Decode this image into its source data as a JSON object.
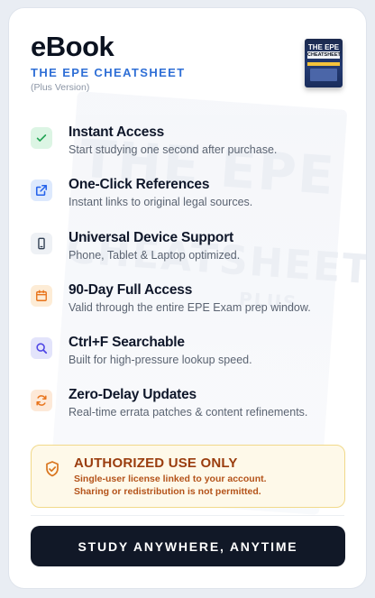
{
  "product": {
    "title": "eBook",
    "subtitle": "THE EPE CHEATSHEET",
    "version": "(Plus Version)",
    "cover": {
      "line1": "THE EPE",
      "line2": "CHEATSHEET"
    }
  },
  "features": [
    {
      "title": "Instant Access",
      "desc": "Start studying one second after purchase.",
      "icon": "check-icon",
      "bg": "#dcf5e4",
      "fg": "#22a454"
    },
    {
      "title": "One-Click References",
      "desc": "Instant links to original legal sources.",
      "icon": "external-link-icon",
      "bg": "#dde9fd",
      "fg": "#2563eb"
    },
    {
      "title": "Universal Device Support",
      "desc": "Phone, Tablet & Laptop optimized.",
      "icon": "phone-icon",
      "bg": "#eef1f5",
      "fg": "#334155"
    },
    {
      "title": "90-Day Full Access",
      "desc": "Valid through the entire EPE Exam prep window.",
      "icon": "calendar-icon",
      "bg": "#fdecd6",
      "fg": "#e8741c"
    },
    {
      "title": "Ctrl+F Searchable",
      "desc": "Built for high-pressure lookup speed.",
      "icon": "search-icon",
      "bg": "#e3e4fb",
      "fg": "#4f46e5"
    },
    {
      "title": "Zero-Delay Updates",
      "desc": "Real-time errata patches & content refinements.",
      "icon": "refresh-icon",
      "bg": "#fde9d8",
      "fg": "#e8741c"
    }
  ],
  "notice": {
    "title": "AUTHORIZED USE ONLY",
    "line1": "Single-user license linked to your account.",
    "line2": "Sharing or redistribution is not permitted.",
    "icon": "shield-check-icon"
  },
  "cta": {
    "label": "STUDY ANYWHERE, ANYTIME"
  },
  "colors": {
    "accent": "#2f6fd6",
    "cta_bg": "#111827",
    "notice_bg": "#fef9e9",
    "notice_text": "#9a3d0e"
  }
}
